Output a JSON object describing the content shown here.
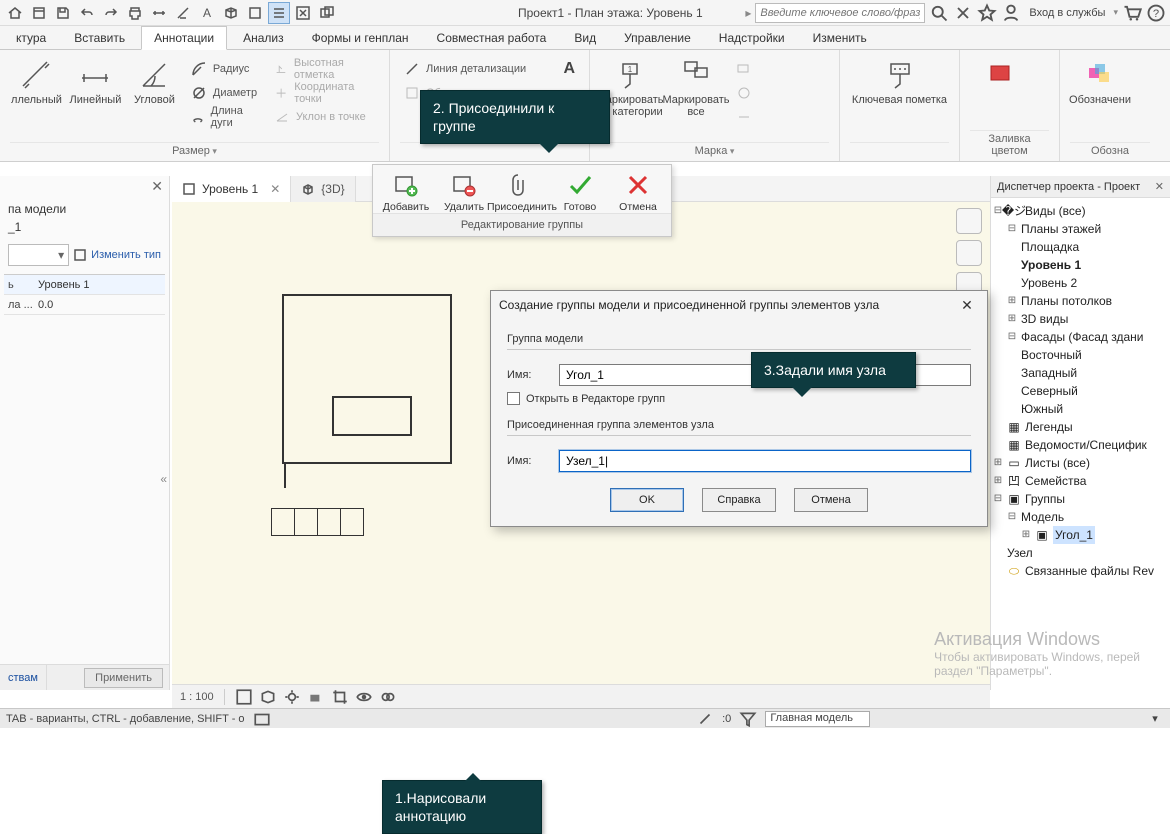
{
  "title": "Проект1 - План этажа: Уровень 1",
  "search_placeholder": "Введите ключевое слово/фразу",
  "login_label": "Вход в службы",
  "tabs": {
    "t0": "ктура",
    "t1": "Вставить",
    "t2": "Аннотации",
    "t3": "Анализ",
    "t4": "Формы и генплан",
    "t5": "Совместная работа",
    "t6": "Вид",
    "t7": "Управление",
    "t8": "Надстройки",
    "t9": "Изменить"
  },
  "ribbon": {
    "dim": {
      "b0": "ллельный",
      "b1": "Линейный",
      "b2": "Угловой",
      "s0": "Радиус",
      "s1": "Диаметр",
      "s2": "Длина дуги",
      "s3": "Высотная отметка",
      "s4": "Координата точки",
      "s5": "Уклон в точке",
      "group": "Размер"
    },
    "g2": {
      "s0": "Линия детализации",
      "s1": "Область",
      "s2": "",
      "group": ""
    },
    "g_tag": {
      "b0": "Маркировать по категории",
      "b1": "Маркировать все",
      "group": "Марка"
    },
    "g_key": {
      "b0": "Ключевая пометка"
    },
    "g_fill": {
      "group": "Заливка цветом"
    },
    "g_last": {
      "b0": "Обозначени",
      "group": "Обозна"
    }
  },
  "callouts": {
    "c1": "1.Нарисовали аннотацию",
    "c2": "2. Присоединили к группе",
    "c3": "3.Задали имя узла"
  },
  "doctabs": {
    "t0": "Уровень 1",
    "t1": "{3D}"
  },
  "props": {
    "header": "па модели",
    "name": "_1",
    "change": "Изменить тип",
    "row1k": "ь",
    "row1v": "Уровень 1",
    "row2k": "ла ...",
    "row2v": "0.0",
    "foot_tab": "ствам",
    "apply": "Применить"
  },
  "grouppanel": {
    "b0": "Добавить",
    "b1": "Удалить",
    "b2": "Присоединить",
    "b3": "Готово",
    "b4": "Отмена",
    "title": "Редактирование группы"
  },
  "dialog": {
    "title": "Создание группы модели и присоединенной группы элементов узла",
    "fs1": "Группа модели",
    "name_label": "Имя:",
    "model_name": "Угол_1",
    "open_editor": "Открыть в Редакторе групп",
    "fs2": "Присоединенная группа элементов узла",
    "detail_name": "Узел_1|",
    "ok": "OK",
    "help": "Справка",
    "cancel": "Отмена"
  },
  "viewbar": {
    "scale": "1 : 100"
  },
  "status": {
    "hint": "TAB - варианты, CTRL - добавление, SHIFT - о",
    "zero": ":0",
    "model": "Главная модель"
  },
  "browser": {
    "title": "Диспетчер проекта - Проект",
    "views": "Виды (все)",
    "plans": "Планы этажей",
    "p0": "Площадка",
    "p1": "Уровень 1",
    "p2": "Уровень 2",
    "ceil": "Планы потолков",
    "v3d": "3D виды",
    "facades": "Фасады (Фасад здани",
    "f0": "Восточный",
    "f1": "Западный",
    "f2": "Северный",
    "f3": "Южный",
    "legends": "Легенды",
    "scheds": "Ведомости/Специфик",
    "sheets": "Листы (все)",
    "families": "Семейства",
    "groups": "Группы",
    "gmodel": "Модель",
    "g_item": "Угол_1",
    "g_detail": "Узел",
    "links": "Связанные файлы Rev"
  },
  "watermark": {
    "l1": "Активация Windows",
    "l2": "Чтобы активировать Windows, перей",
    "l3": "раздел \"Параметры\"."
  }
}
